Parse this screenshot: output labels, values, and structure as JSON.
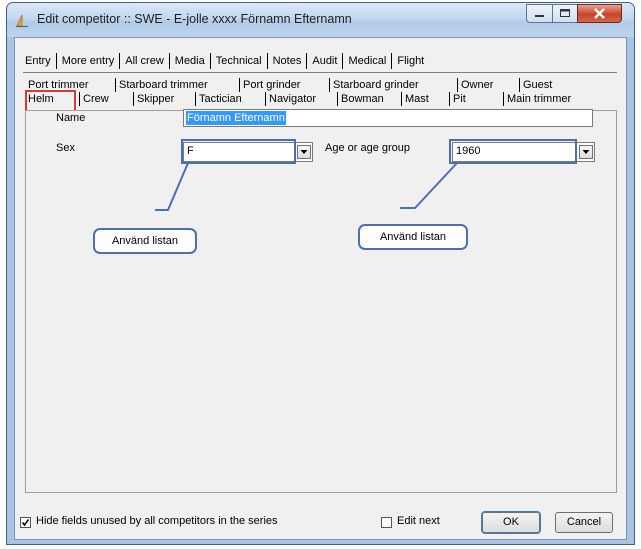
{
  "window": {
    "title": "Edit competitor :: SWE - E-jolle xxxx Förnamn Efternamn"
  },
  "outer_tabs": [
    "Entry",
    "More entry",
    "All crew",
    "Media",
    "Technical",
    "Notes",
    "Audit",
    "Medical",
    "Flight"
  ],
  "outer_tabs_active": "All crew",
  "inner_tabs": {
    "row1": [
      "Port trimmer",
      "Starboard trimmer",
      "Port grinder",
      "Starboard grinder",
      "Owner",
      "Guest"
    ],
    "row2": [
      "Helm",
      "Crew",
      "Skipper",
      "Tactician",
      "Navigator",
      "Bowman",
      "Mast",
      "Pit",
      "Main trimmer"
    ],
    "active": "Helm"
  },
  "form": {
    "name_label": "Name",
    "name_value": "Förnamn Efternamn",
    "sex_label": "Sex",
    "sex_value": "F",
    "age_label": "Age or age group",
    "age_value": "1960"
  },
  "callouts": {
    "left": "Använd listan",
    "right": "Använd listan"
  },
  "footer": {
    "hide_fields_label": "Hide fields unused by all competitors in the series",
    "hide_fields_checked": true,
    "edit_next_label": "Edit next",
    "edit_next_checked": false,
    "ok_label": "OK",
    "cancel_label": "Cancel"
  },
  "colors": {
    "highlight_blue": "#4c6fb3",
    "helm_red": "#d83a3a",
    "selection": "#3399ff"
  }
}
